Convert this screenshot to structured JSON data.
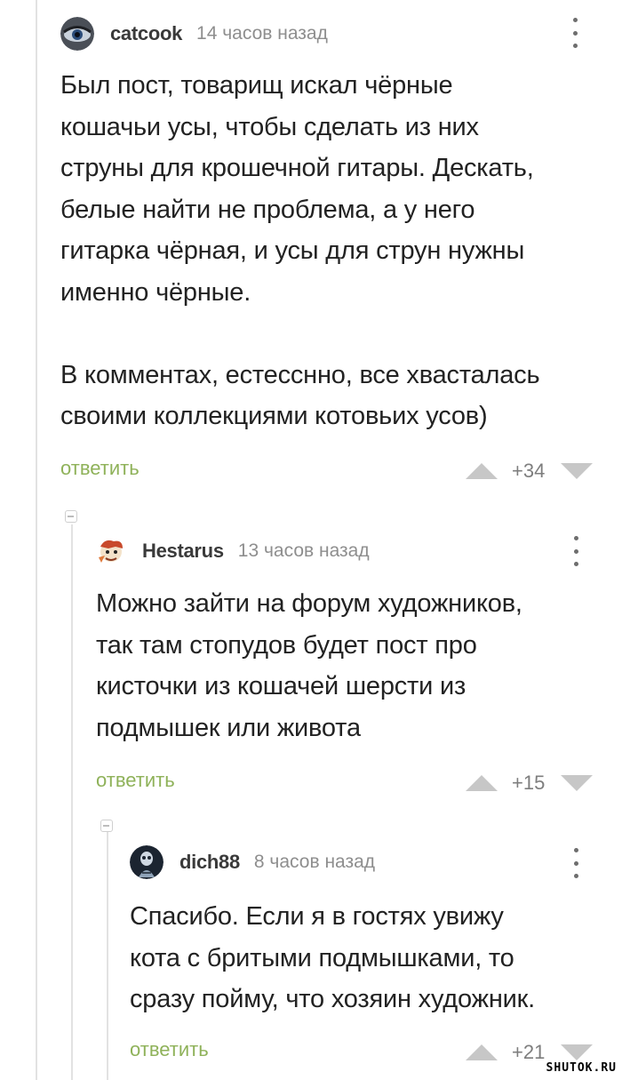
{
  "comments": [
    {
      "username": "catcook",
      "time": "14 часов назад",
      "text": "Был пост, товарищ искал чёрные\nкошачьи усы, чтобы сделать из них\nструны для крошечной гитары. Дескать,\nбелые найти не проблема, а у него\nгитарка чёрная, и усы для струн нужны\nименно чёрные.\n\nВ комментах, естесснно, все хвасталась\nсвоими коллекциями котовьих усов)",
      "reply_label": "ответить",
      "score": "+34",
      "avatar": "eye-avatar"
    },
    {
      "username": "Hestarus",
      "time": "13 часов назад",
      "text": "Можно зайти на форум художников,\nтак там стопудов будет пост про\nкисточки из кошачей шерсти из\nподмышек или живота",
      "reply_label": "ответить",
      "score": "+15",
      "avatar": "cartoon-avatar"
    },
    {
      "username": "dich88",
      "time": "8 часов назад",
      "text": "Спасибо. Если я в гостях увижу\nкота с бритыми подмышками, то\nсразу пойму, что хозяин художник.",
      "reply_label": "ответить",
      "score": "+21",
      "avatar": "skeleton-avatar"
    }
  ],
  "watermark": "SHUTOK.RU",
  "colors": {
    "reply": "#8fb25a",
    "score": "#7e7e7e",
    "arrows": "#c7c7c7",
    "thread_line": "#e2e2e2"
  }
}
